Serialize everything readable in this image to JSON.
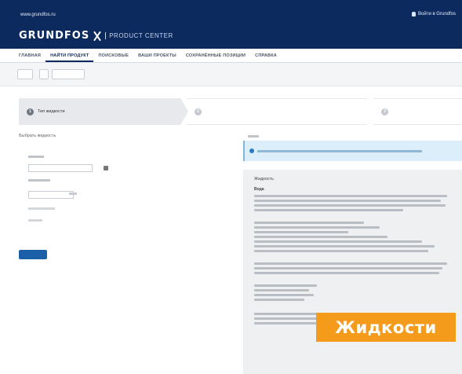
{
  "top_bar": {
    "site_label": "www.grundfos.ru",
    "login_label": "Войти в Grundfos",
    "user_icon": "user-icon"
  },
  "logo": {
    "brand": "GRUNDFOS",
    "product": "PRODUCT CENTER"
  },
  "nav": {
    "items": [
      {
        "label": "ГЛАВНАЯ",
        "active": false
      },
      {
        "label": "НАЙТИ ПРОДУКТ",
        "active": true
      },
      {
        "label": "ПОИСКОВЫЕ",
        "active": false
      },
      {
        "label": "ВАШИ ПРОЕКТЫ",
        "active": false
      },
      {
        "label": "СОХРАНЁННЫЕ ПОЗИЦИИ",
        "active": false
      },
      {
        "label": "СПРАВКА",
        "active": false
      }
    ]
  },
  "steps": [
    {
      "number": "1",
      "label": "Тип жидкости"
    },
    {
      "number": "2",
      "label": ""
    },
    {
      "number": "3",
      "label": ""
    }
  ],
  "form": {
    "section_title": "Выбрать жидкость"
  },
  "info_panel": {
    "title": "Жидкость",
    "subheading": "Вода"
  },
  "banner": {
    "text": "Жидкости"
  },
  "colors": {
    "header": "#0c2a5e",
    "primary": "#1b5fa8",
    "info_bg": "#dbeef9",
    "banner": "#f59b1b"
  }
}
